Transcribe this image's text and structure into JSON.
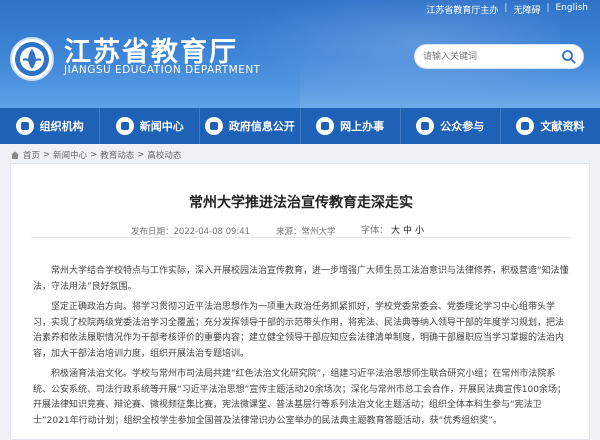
{
  "header": {
    "top_links": [
      "江苏省教育厅主办",
      "无障碍",
      "English"
    ],
    "brand_cn": "江苏省教育厅",
    "brand_en": "JIANGSU EDUCATION DEPARTMENT",
    "search_placeholder": "请输入关键词"
  },
  "nav": [
    {
      "label": "组织机构",
      "icon": "org-icon"
    },
    {
      "label": "新闻中心",
      "icon": "news-icon"
    },
    {
      "label": "政府信息公开",
      "icon": "info-icon"
    },
    {
      "label": "网上办事",
      "icon": "service-icon"
    },
    {
      "label": "公众参与",
      "icon": "people-icon"
    },
    {
      "label": "文献资料",
      "icon": "docs-icon"
    }
  ],
  "breadcrumb": [
    "首页",
    ">",
    "新闻中心",
    ">",
    "教育动态",
    ">",
    "高校动态"
  ],
  "article": {
    "title": "常州大学推进法治宣传教育走深走实",
    "pubtime": "发布日期：2022-04-08 09:41",
    "source": "来源：常州大学",
    "font_size_label": "字体：",
    "font_sizes": [
      "大",
      "中",
      "小"
    ],
    "paragraphs": [
      "常州大学结合学校特点与工作实际，深入开展校园法治宣传教育，进一步增强广大师生员工法治意识与法律修养，积极营造“知法懂法，守法用法”良好氛围。",
      "坚定正确政治方向。将学习贯彻习近平法治思想作为一项重大政治任务抓紧抓好，学校党委常委会、党委理论学习中心组带头学习，实现了校院两级党委法治学习全覆盖；充分发挥领导干部的示范带头作用，将宪法、民法典等纳入领导干部的年度学习规划，把法治素养和依法履职情况作为干部考核评价的重要内容；建立健全领导干部应知应会法律清单制度，明确干部履职应当学习掌握的法治内容，加大干部法治培训力度，组织开展法治专题培训。",
      "积极涵育法治文化。学校与常州市司法局共建“红色法治文化研究院”，组建习近平法治思想师生联合研究小组；在常州市法院系统、公安系统、司法行政系统等开展“习近平法治思想”宣传主题活动20余场次；深化与常州市总工会合作，开展民法典宣传100余场；开展法律知识竞赛、辩论赛、微视频征集比赛，宪法微课堂、普法基层行等系列法治文化主题活动；组织全体本科生参与“宪法卫士”2021年行动计划；组织全校学生参加全国普及法律常识办公室举办的民法典主题教育答题活动，获“优秀组织奖”。"
    ]
  },
  "colors": {
    "header_blue": "#3f86d8",
    "nav_blue": "#1e62b8"
  }
}
